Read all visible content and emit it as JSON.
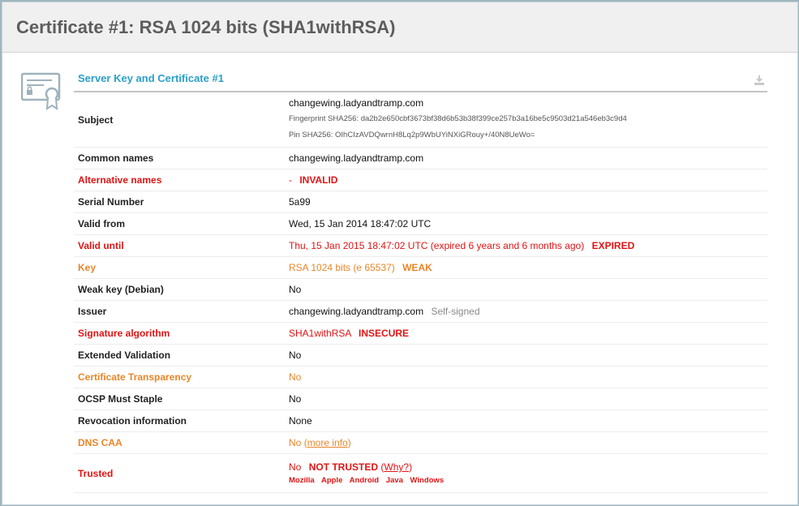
{
  "header": {
    "title": "Certificate #1: RSA 1024 bits (SHA1withRSA)"
  },
  "section": {
    "title": "Server Key and Certificate #1"
  },
  "rows": {
    "subject": {
      "label": "Subject",
      "value": "changewing.ladyandtramp.com",
      "fingerprint": "Fingerprint SHA256: da2b2e650cbf3673bf38d6b53b38f399ce257b3a16be5c9503d21a546eb3c9d4",
      "pin": "Pin SHA256: OIhCIzAVDQwrnH8Lq2p9WbUYiNXiGRouy+/40N8UeWo="
    },
    "common_names": {
      "label": "Common names",
      "value": "changewing.ladyandtramp.com"
    },
    "alternative_names": {
      "label": "Alternative names",
      "value": "-",
      "tag": "INVALID"
    },
    "serial_number": {
      "label": "Serial Number",
      "value": "5a99"
    },
    "valid_from": {
      "label": "Valid from",
      "value": "Wed, 15 Jan 2014 18:47:02 UTC"
    },
    "valid_until": {
      "label": "Valid until",
      "value": "Thu, 15 Jan 2015 18:47:02 UTC (expired 6 years and 6 months ago)",
      "tag": "EXPIRED"
    },
    "key": {
      "label": "Key",
      "value": "RSA 1024 bits (e 65537)",
      "tag": "WEAK"
    },
    "weak_key": {
      "label": "Weak key (Debian)",
      "value": "No"
    },
    "issuer": {
      "label": "Issuer",
      "value": "changewing.ladyandtramp.com",
      "note": "Self-signed"
    },
    "signature_algorithm": {
      "label": "Signature algorithm",
      "value": "SHA1withRSA",
      "tag": "INSECURE"
    },
    "extended_validation": {
      "label": "Extended Validation",
      "value": "No"
    },
    "certificate_transparency": {
      "label": "Certificate Transparency",
      "value": "No"
    },
    "ocsp_must_staple": {
      "label": "OCSP Must Staple",
      "value": "No"
    },
    "revocation_information": {
      "label": "Revocation information",
      "value": "None"
    },
    "dns_caa": {
      "label": "DNS CAA",
      "value": "No",
      "link_open": "(",
      "link": "more info",
      "link_close": ")"
    },
    "trusted": {
      "label": "Trusted",
      "value": "No",
      "tag": "NOT TRUSTED",
      "link_open": "(",
      "link": "Why?",
      "link_close": ")",
      "stores": [
        "Mozilla",
        "Apple",
        "Android",
        "Java",
        "Windows"
      ]
    }
  },
  "colors": {
    "red": "#e01414",
    "orange": "#e8862a",
    "accent": "#2a9fc8"
  },
  "icons": {
    "certificate": "certificate-icon",
    "download": "download-icon"
  }
}
